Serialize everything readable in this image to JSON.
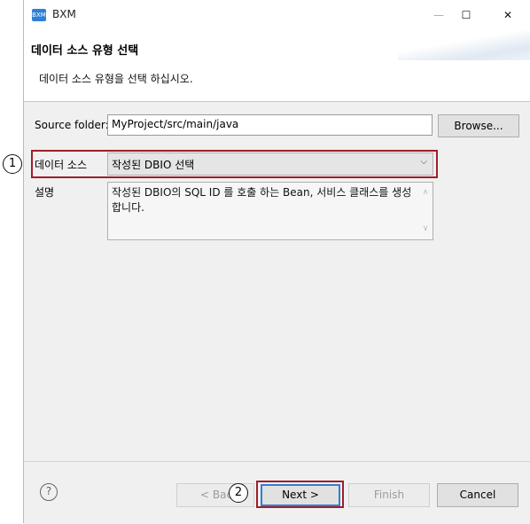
{
  "window": {
    "title": "BXM",
    "icon_label": "BXM"
  },
  "controls": {
    "minimize": "—",
    "maximize": "☐",
    "close": "✕"
  },
  "header": {
    "title": "데이터 소스 유형 선택",
    "description": "데이터 소스 유형을 선택 하십시오."
  },
  "form": {
    "source_folder_label": "Source folder:",
    "source_folder_value": "MyProject/src/main/java",
    "browse_label": "Browse...",
    "data_source_label": "데이터 소스",
    "data_source_value": "작성된 DBIO 선택",
    "description_label": "설명",
    "description_text": "작성된 DBIO의 SQL ID 를 호출 하는 Bean, 서비스 클래스를 생성 합니다."
  },
  "buttons": {
    "back": "< Bac",
    "next": "Next >",
    "finish": "Finish",
    "cancel": "Cancel",
    "help": "?"
  },
  "callouts": {
    "one": "1",
    "two": "2"
  },
  "colors": {
    "highlight": "#a01d2a",
    "accent": "#2f7fd7"
  }
}
